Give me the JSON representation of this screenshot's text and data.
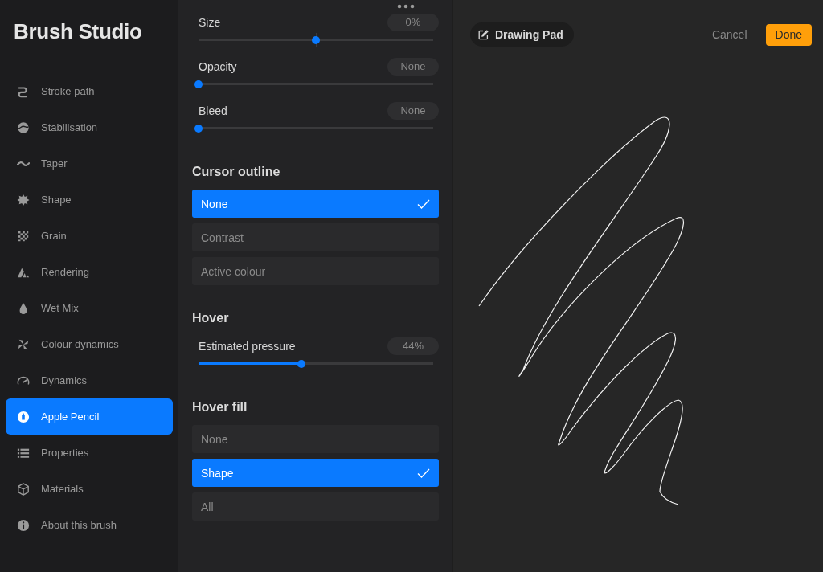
{
  "sidebar": {
    "title": "Brush Studio",
    "items": [
      {
        "label": "Stroke path",
        "selected": false
      },
      {
        "label": "Stabilisation",
        "selected": false
      },
      {
        "label": "Taper",
        "selected": false
      },
      {
        "label": "Shape",
        "selected": false
      },
      {
        "label": "Grain",
        "selected": false
      },
      {
        "label": "Rendering",
        "selected": false
      },
      {
        "label": "Wet Mix",
        "selected": false
      },
      {
        "label": "Colour dynamics",
        "selected": false
      },
      {
        "label": "Dynamics",
        "selected": false
      },
      {
        "label": "Apple Pencil",
        "selected": true
      },
      {
        "label": "Properties",
        "selected": false
      },
      {
        "label": "Materials",
        "selected": false
      },
      {
        "label": "About this brush",
        "selected": false
      }
    ]
  },
  "settings": {
    "sliders": [
      {
        "label": "Size",
        "value": "0%",
        "level": 0.5,
        "kind": "centered"
      },
      {
        "label": "Opacity",
        "value": "None",
        "level": 0,
        "kind": "plain"
      },
      {
        "label": "Bleed",
        "value": "None",
        "level": 0,
        "kind": "plain"
      }
    ],
    "sections": [
      {
        "heading": "Cursor outline",
        "kind": "options",
        "options": [
          {
            "label": "None",
            "selected": true
          },
          {
            "label": "Contrast",
            "selected": false
          },
          {
            "label": "Active colour",
            "selected": false
          }
        ]
      },
      {
        "heading": "Hover",
        "kind": "sliders",
        "sliders": [
          {
            "label": "Estimated pressure",
            "value": "44%",
            "level": 0.44,
            "kind": "plain"
          }
        ]
      },
      {
        "heading": "Hover fill",
        "kind": "options",
        "options": [
          {
            "label": "None",
            "selected": false
          },
          {
            "label": "Shape",
            "selected": true
          },
          {
            "label": "All",
            "selected": false
          }
        ]
      }
    ]
  },
  "drawing_pad": {
    "title": "Drawing Pad",
    "cancel": "Cancel",
    "done": "Done"
  }
}
